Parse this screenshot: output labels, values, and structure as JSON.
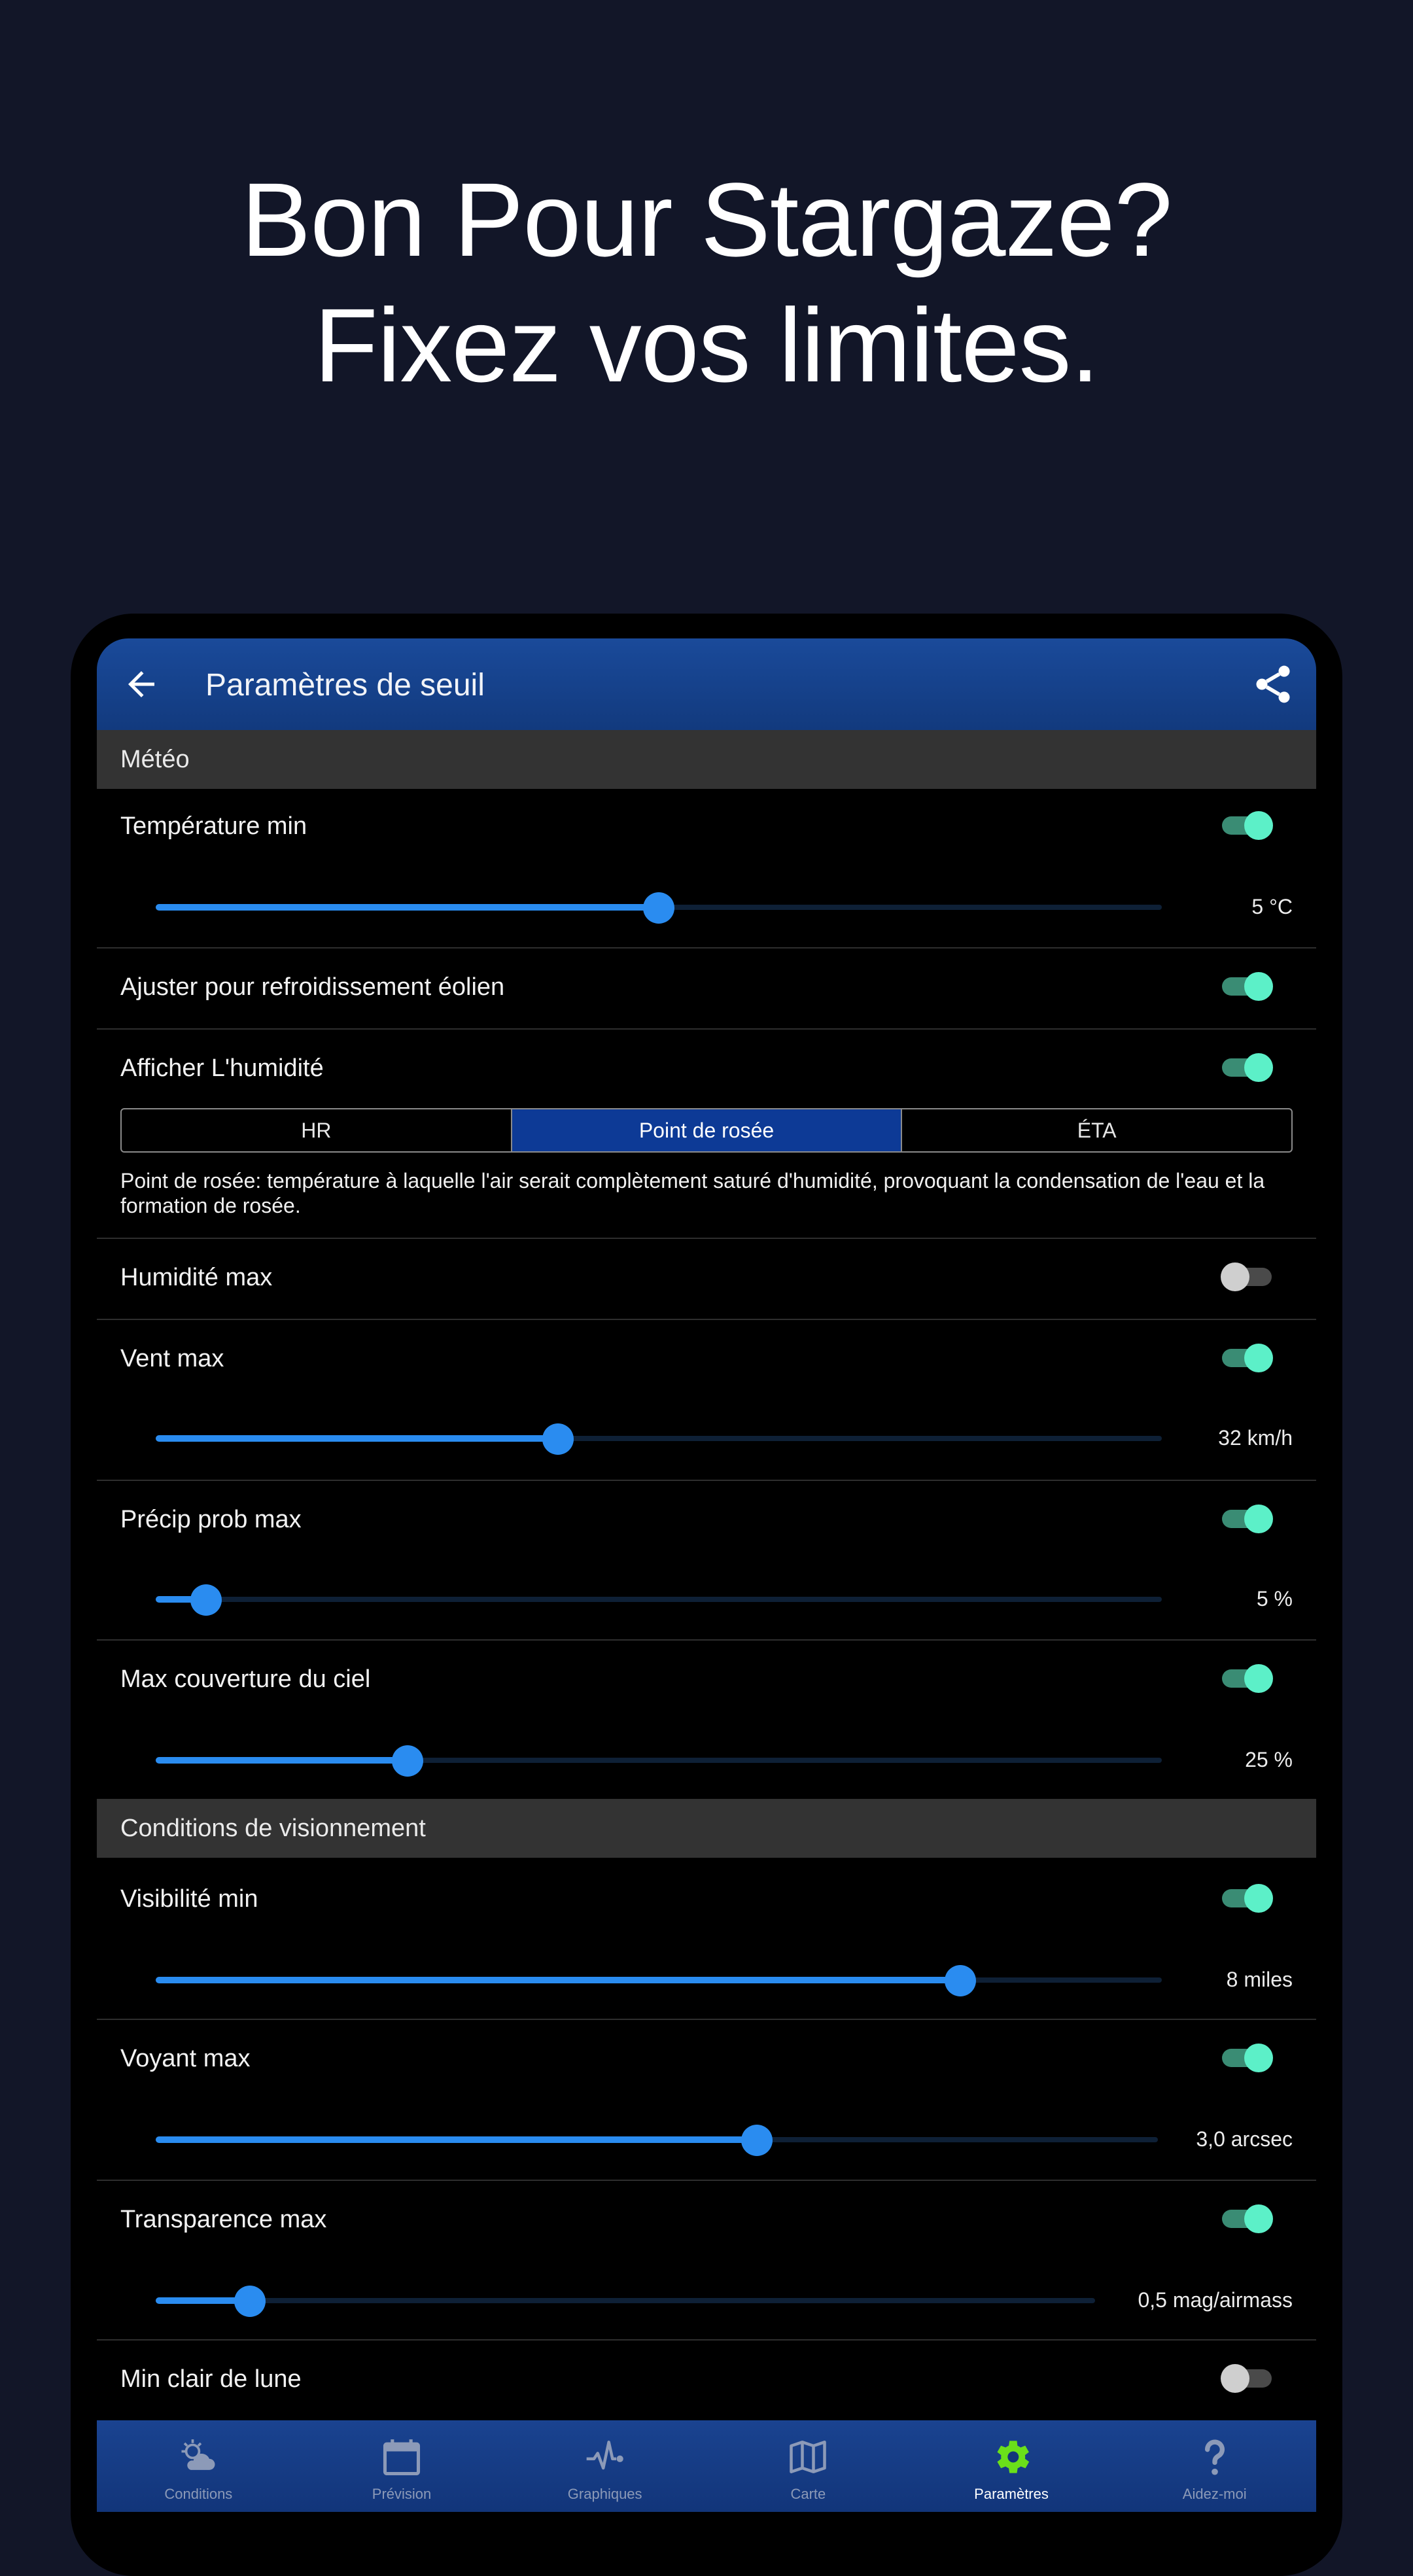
{
  "promo": {
    "line1": "Bon Pour Stargaze?",
    "line2": "Fixez vos limites."
  },
  "appbar": {
    "title": "Paramètres de seuil",
    "back_icon": "arrow-back-icon",
    "share_icon": "share-icon"
  },
  "sections": {
    "weather": "Météo",
    "viewing": "Conditions de visionnement"
  },
  "rows": {
    "temp_min": {
      "label": "Température min",
      "enabled": true,
      "value": "5 °C",
      "fraction": 0.5
    },
    "wind_chill": {
      "label": "Ajuster pour refroidissement éolien",
      "enabled": true
    },
    "show_humidity": {
      "label": "Afficher L'humidité",
      "enabled": true
    },
    "humidity_max": {
      "label": "Humidité max",
      "enabled": false
    },
    "wind_max": {
      "label": "Vent max",
      "enabled": true,
      "value": "32 km/h",
      "fraction": 0.4
    },
    "precip_max": {
      "label": "Précip prob max",
      "enabled": true,
      "value": "5 %",
      "fraction": 0.05
    },
    "cloud_max": {
      "label": "Max couverture du ciel",
      "enabled": true,
      "value": "25 %",
      "fraction": 0.25
    },
    "visibility_min": {
      "label": "Visibilité min",
      "enabled": true,
      "value": "8 miles",
      "fraction": 0.8
    },
    "seeing_max": {
      "label": "Voyant max",
      "enabled": true,
      "value": "3,0 arcsec",
      "fraction": 0.6
    },
    "transparency_max": {
      "label": "Transparence max",
      "enabled": true,
      "value": "0,5 mag/airmass",
      "fraction": 0.1
    },
    "moon_min": {
      "label": "Min clair de lune",
      "enabled": false
    }
  },
  "humidity_mode": {
    "options": [
      "HR",
      "Point de rosée",
      "ÉTA"
    ],
    "selected": "Point de rosée",
    "description": "Point de rosée: température à laquelle l'air serait complètement saturé d'humidité, provoquant la condensation de l'eau et la formation de rosée."
  },
  "bottom_nav": [
    {
      "label": "Conditions",
      "icon": "partly-cloudy-icon"
    },
    {
      "label": "Prévision",
      "icon": "calendar-icon"
    },
    {
      "label": "Graphiques",
      "icon": "pulse-chart-icon"
    },
    {
      "label": "Carte",
      "icon": "map-icon"
    },
    {
      "label": "Paramètres",
      "icon": "gear-icon",
      "active": true
    },
    {
      "label": "Aidez-moi",
      "icon": "help-icon"
    }
  ],
  "colors": {
    "background": "#121628",
    "accent_blue": "#2a8cf0",
    "toggle_on": "#5cf0c8",
    "active_gear": "#6ae01a"
  }
}
